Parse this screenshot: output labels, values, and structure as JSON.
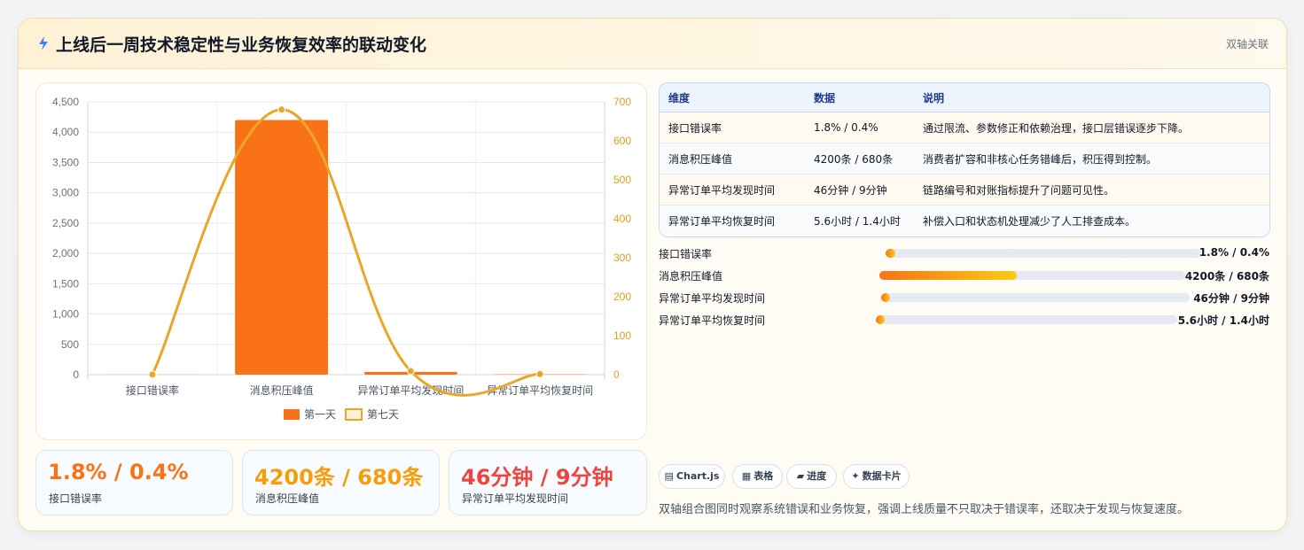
{
  "header": {
    "icon": "lightning-icon",
    "title": "上线后一周技术稳定性与业务恢复效率的联动变化",
    "tag": "双轴关联"
  },
  "colors": {
    "bar": "#f97316",
    "line": "#e9a72a",
    "orange_value": "#f97316",
    "amber_value": "#f59e0b",
    "red_value": "#ef4444"
  },
  "chart_data": {
    "type": "bar",
    "categories": [
      "接口错误率",
      "消息积压峰值",
      "异常订单平均发现时间",
      "异常订单平均恢复时间"
    ],
    "series": [
      {
        "name": "第一天",
        "type": "bar",
        "axis": "left",
        "values": [
          1.8,
          4200,
          46,
          5.6
        ]
      },
      {
        "name": "第七天",
        "type": "line",
        "axis": "right",
        "values": [
          0.4,
          680,
          9,
          1.4
        ]
      }
    ],
    "y_left": {
      "min": 0,
      "max": 4500,
      "ticks": [
        "0",
        "500",
        "1,000",
        "1,500",
        "2,000",
        "2,500",
        "3,000",
        "3,500",
        "4,000",
        "4,500"
      ]
    },
    "y_right": {
      "min": 0,
      "max": 700,
      "ticks": [
        "0",
        "100",
        "200",
        "300",
        "400",
        "500",
        "600",
        "700"
      ]
    },
    "legend_position": "bottom",
    "grid": true
  },
  "stats": [
    {
      "value": "1.8% / 0.4%",
      "label": "接口错误率"
    },
    {
      "value": "4200条 / 680条",
      "label": "消息积压峰值"
    },
    {
      "value": "46分钟 / 9分钟",
      "label": "异常订单平均发现时间"
    }
  ],
  "table": {
    "headers": [
      "维度",
      "数据",
      "说明"
    ],
    "rows": [
      [
        "接口错误率",
        "1.8% / 0.4%",
        "通过限流、参数修正和依赖治理，接口层错误逐步下降。"
      ],
      [
        "消息积压峰值",
        "4200条 / 680条",
        "消费者扩容和非核心任务错峰后，积压得到控制。"
      ],
      [
        "异常订单平均发现时间",
        "46分钟 / 9分钟",
        "链路编号和对账指标提升了问题可见性。"
      ],
      [
        "异常订单平均恢复时间",
        "5.6小时 / 1.4小时",
        "补偿入口和状态机处理减少了人工排查成本。"
      ]
    ]
  },
  "progress": [
    {
      "label": "接口错误率",
      "value": "1.8% / 0.4%",
      "fill": 0.03
    },
    {
      "label": "消息积压峰值",
      "value": "4200条 / 680条",
      "fill": 0.45
    },
    {
      "label": "异常订单平均发现时间",
      "value": "46分钟 / 9分钟",
      "fill": 0.03
    },
    {
      "label": "异常订单平均恢复时间",
      "value": "5.6小时 / 1.4小时",
      "fill": 0.03
    }
  ],
  "pills": [
    {
      "icon": "▤",
      "label": "Chart.js"
    },
    {
      "icon": "▦",
      "label": "表格"
    },
    {
      "icon": "▰",
      "label": "进度"
    },
    {
      "icon": "✦",
      "label": "数据卡片"
    }
  ],
  "footer_note": "双轴组合图同时观察系统错误和业务恢复，强调上线质量不只取决于错误率，还取决于发现与恢复速度。"
}
